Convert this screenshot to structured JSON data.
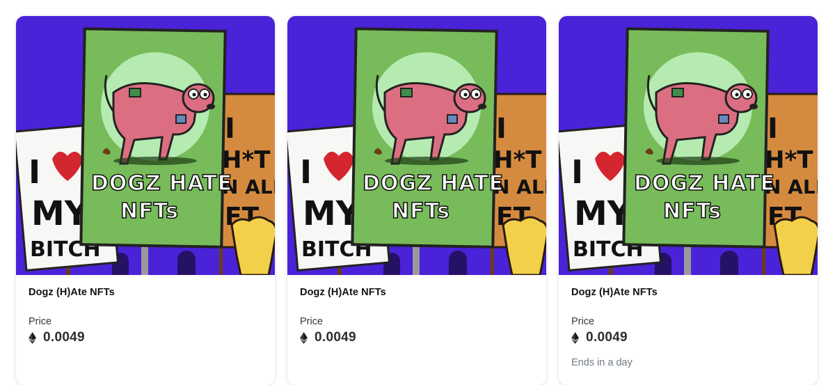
{
  "cards": [
    {
      "title": "Dogz (H)Ate NFTs",
      "price_label": "Price",
      "price": "0.0049",
      "currency_icon": "ethereum-icon",
      "ends": "",
      "art": {
        "left_sign": [
          "I",
          "MY",
          "BITCH"
        ],
        "center_sign": [
          "DOGZ HATE",
          "NFTs"
        ],
        "right_sign": [
          "I",
          "H*T",
          "N ALL",
          "FT"
        ]
      }
    },
    {
      "title": "Dogz (H)Ate NFTs",
      "price_label": "Price",
      "price": "0.0049",
      "currency_icon": "ethereum-icon",
      "ends": "",
      "art": {
        "left_sign": [
          "I",
          "MY",
          "BITCH"
        ],
        "center_sign": [
          "DOGZ HATE",
          "NFTs"
        ],
        "right_sign": [
          "I",
          "H*T",
          "N ALL",
          "FT"
        ]
      }
    },
    {
      "title": "Dogz (H)Ate NFTs",
      "price_label": "Price",
      "price": "0.0049",
      "currency_icon": "ethereum-icon",
      "ends": "Ends in a day",
      "art": {
        "left_sign": [
          "I",
          "MY",
          "BITCH"
        ],
        "center_sign": [
          "DOGZ HATE",
          "NFTs"
        ],
        "right_sign": [
          "I",
          "H*T",
          "N ALL",
          "FT"
        ]
      }
    }
  ],
  "colors": {
    "art_background": "#4a22d8",
    "center_sign": "#78bb5a",
    "right_sign": "#d58b3f",
    "dog": "#dc6e82"
  }
}
